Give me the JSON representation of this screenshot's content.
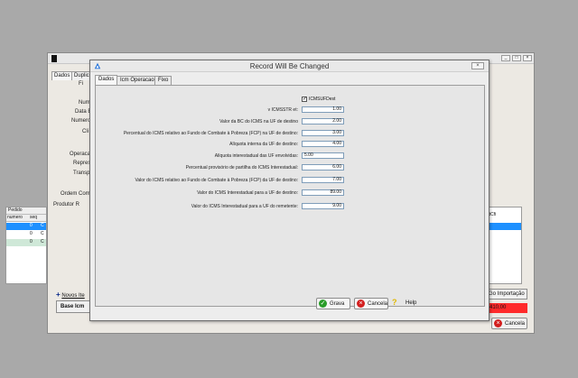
{
  "background_window": {
    "close_label": "×",
    "tabs": [
      "Dados",
      "Duplic"
    ],
    "labels": [
      "Fi",
      "Nume",
      "Data E",
      "Numero",
      "Cli",
      "Operaca",
      "Repres",
      "Transpo",
      "Ordem Comp",
      "Produtor R"
    ],
    "table_headers": [
      "Pedido",
      "numero",
      "seq"
    ],
    "table_rows": [
      [
        "0",
        "C"
      ],
      [
        "0",
        "C"
      ],
      [
        "0",
        "C"
      ]
    ],
    "right_table_header": "atCfi",
    "add_item_label": "Novos Ite",
    "base_label": "Base Icm",
    "import_label": "Go Importação",
    "total_value": "410,00",
    "cancel_label": "Cancela"
  },
  "dialog": {
    "title": "Record Will Be Changed",
    "close_label": "×",
    "tabs": [
      "Dados",
      "Icm Operacao",
      "Fixo"
    ],
    "checkbox": {
      "label": "ICMSUFDest",
      "checked": true,
      "mark": "✓"
    },
    "fields": [
      {
        "label": "v ICMSSTR et:",
        "value": "1.00"
      },
      {
        "label": "Valor da BC do ICMS na UF de destino",
        "value": "2.00"
      },
      {
        "label": "Percentual do ICMS relativo ao Fundo de Combate à Pobreza (FCP) na UF de destino:",
        "value": "3.00"
      },
      {
        "label": "Alíquota interna da UF de destino:",
        "value": "4.00"
      },
      {
        "label": "Alíquota interestadual das UF envolvidas:",
        "value": "5.00"
      },
      {
        "label": "Percentual provisório de partilha do ICMS Interestadual:",
        "value": "6.00"
      },
      {
        "label": "Valor do ICMS relativo ao Fundo de Combate à Pobreza (FCP) da UF de destino:",
        "value": "7.00"
      },
      {
        "label": "Valor do ICMS Interestadual para a UF de destino:",
        "value": "89.00"
      },
      {
        "label": "Valor do ICMS Interestadual para a UF do remetente:",
        "value": "9.00"
      }
    ],
    "buttons": {
      "save": "Grava",
      "cancel": "Cancela",
      "help": "Help"
    }
  },
  "colors": {
    "save_icon": "#2a9d2a",
    "cancel_icon": "#d32020",
    "help_icon": "#e0b800",
    "selection": "#1e90ff",
    "desktop": "#a9a9a9"
  },
  "icons": {
    "save": "check-circle-icon",
    "cancel": "x-circle-icon",
    "help": "question-icon",
    "app": "app-logo-icon",
    "add": "plus-icon"
  }
}
